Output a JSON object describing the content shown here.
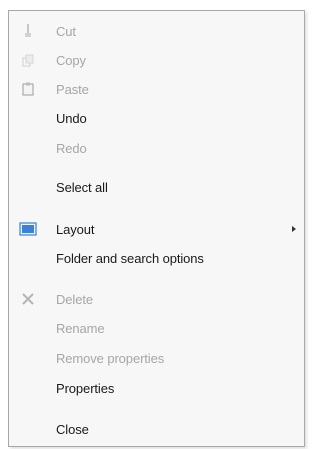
{
  "menu": {
    "items": [
      {
        "label": "Cut",
        "enabled": false,
        "icon": "cut-icon"
      },
      {
        "label": "Copy",
        "enabled": false,
        "icon": "copy-icon"
      },
      {
        "label": "Paste",
        "enabled": false,
        "icon": "paste-icon"
      },
      {
        "label": "Undo",
        "enabled": true
      },
      {
        "label": "Redo",
        "enabled": false
      },
      {
        "label": "Select all",
        "enabled": true
      },
      {
        "label": "Layout",
        "enabled": true,
        "icon": "layout-icon",
        "submenu": true
      },
      {
        "label": "Folder and search options",
        "enabled": true
      },
      {
        "label": "Delete",
        "enabled": false,
        "icon": "delete-icon"
      },
      {
        "label": "Rename",
        "enabled": false
      },
      {
        "label": "Remove properties",
        "enabled": false
      },
      {
        "label": "Properties",
        "enabled": true
      },
      {
        "label": "Close",
        "enabled": true
      }
    ]
  },
  "colors": {
    "enabled_text": "#1a1a1a",
    "disabled_text": "#a6a6a6",
    "layout_icon_blue": "#3b82d6"
  }
}
